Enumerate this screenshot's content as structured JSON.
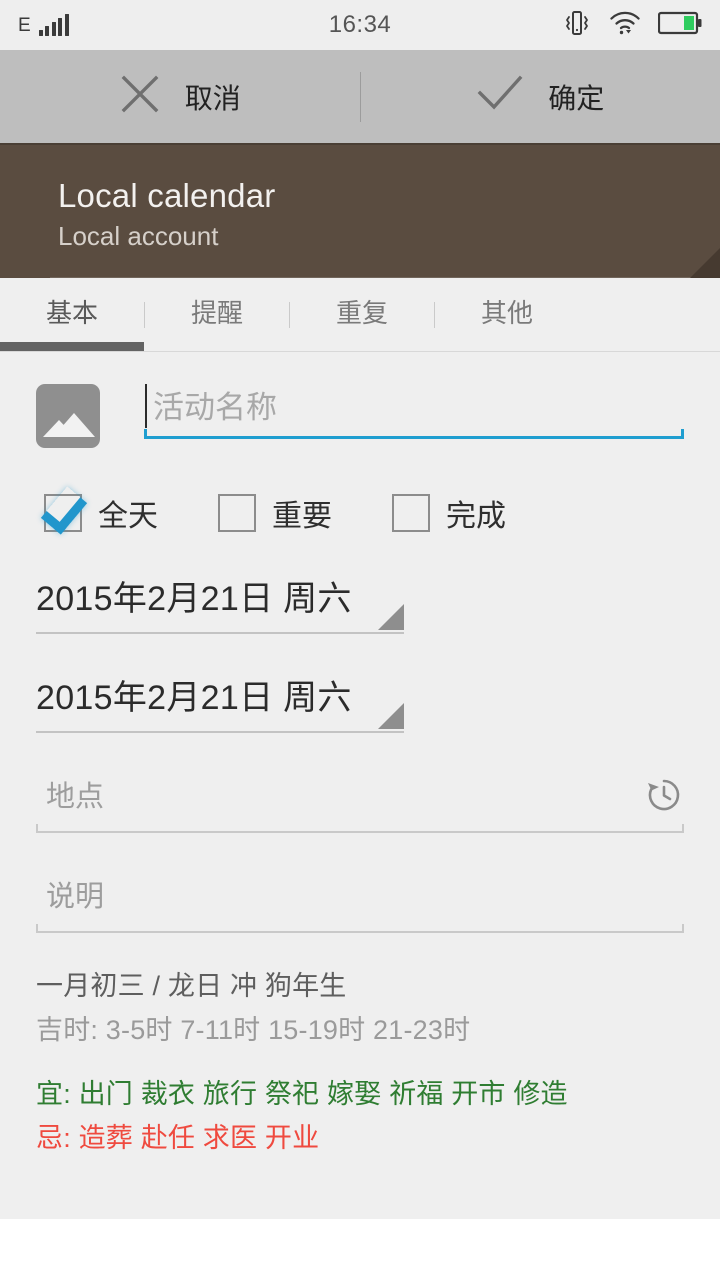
{
  "status_bar": {
    "network_type": "E",
    "signal_bars": 5,
    "time": "16:34",
    "icons": [
      "vibrate-icon",
      "wifi-icon",
      "battery-icon"
    ],
    "battery_level_pct": 55,
    "battery_color": "#2ecc5e",
    "background": "#eeeeee",
    "text_color": "#555555"
  },
  "action_bar": {
    "background": "#bebebe",
    "cancel_label": "取消",
    "cancel_icon": "close-icon",
    "confirm_label": "确定",
    "confirm_icon": "check-icon"
  },
  "calendar_header": {
    "background": "#5a4c40",
    "title": "Local calendar",
    "subtitle": "Local account",
    "corner_icon": "expand-corner-icon"
  },
  "tabs": {
    "active_index": 0,
    "indicator_color": "#636363",
    "items": [
      {
        "label": "基本"
      },
      {
        "label": "提醒"
      },
      {
        "label": "重复"
      },
      {
        "label": "其他"
      }
    ]
  },
  "form": {
    "thumbnail_icon": "image-icon",
    "title_field": {
      "value": "",
      "placeholder": "活动名称",
      "focused": true,
      "accent_color": "#1f9ed0"
    },
    "checkboxes": [
      {
        "label": "全天",
        "checked": true
      },
      {
        "label": "重要",
        "checked": false
      },
      {
        "label": "完成",
        "checked": false
      }
    ],
    "start_date": "2015年2月21日 周六",
    "end_date": "2015年2月21日 周六",
    "location_field": {
      "value": "",
      "placeholder": "地点",
      "trailing_icon": "history-icon"
    },
    "description_field": {
      "value": "",
      "placeholder": "说明"
    }
  },
  "lunar_info": {
    "date_line": "一月初三 / 龙日 冲 狗年生",
    "auspicious_hours": "吉时: 3-5时 7-11时 15-19时 21-23时",
    "good_label": "宜:",
    "good_items": "出门 裁衣 旅行 祭祀 嫁娶 祈福 开市 修造",
    "good_color": "#2f7d32",
    "bad_label": "忌:",
    "bad_items": "造葬 赴任 求医 开业",
    "bad_color": "#ef4a3f"
  }
}
